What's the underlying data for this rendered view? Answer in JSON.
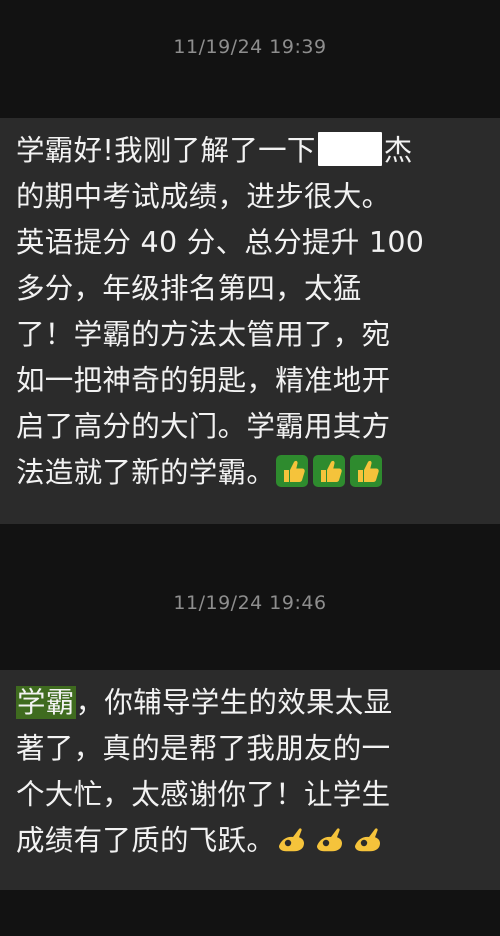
{
  "messages": [
    {
      "timestamp": "11/19/24 19:39",
      "lines": [
        [
          "学霸好!我刚了解了一下",
          "杰"
        ],
        "的期中考试成绩，进步很大。",
        "英语提分 40 分、总分提升 100",
        "多分，年级排名第四，太猛",
        "了！学霸的方法太管用了，宛",
        "如一把神奇的钥匙，精准地开",
        "启了高分的大门。学霸用其方",
        "法造就了新的学霸。"
      ],
      "emojis": [
        "thumbs-up",
        "thumbs-up",
        "thumbs-up"
      ]
    },
    {
      "timestamp": "11/19/24 19:46",
      "highlight": "学霸",
      "lines": [
        "，你辅导学生的效果太显",
        "著了，真的是帮了我朋友的一",
        "个大忙，太感谢你了！让学生",
        "成绩有了质的飞跃。"
      ],
      "emojis": [
        "ok-hand",
        "ok-hand",
        "ok-hand"
      ]
    }
  ],
  "colors": {
    "background": "#121212",
    "bubble": "#2b2b2b",
    "text": "#f2f2f2",
    "timestamp": "#8e8e8e",
    "highlight": "#3f6b1f",
    "thumb_bg": "#2e8b2e",
    "thumb_hand": "#f5c33b",
    "ok_hand": "#f5c33b"
  }
}
